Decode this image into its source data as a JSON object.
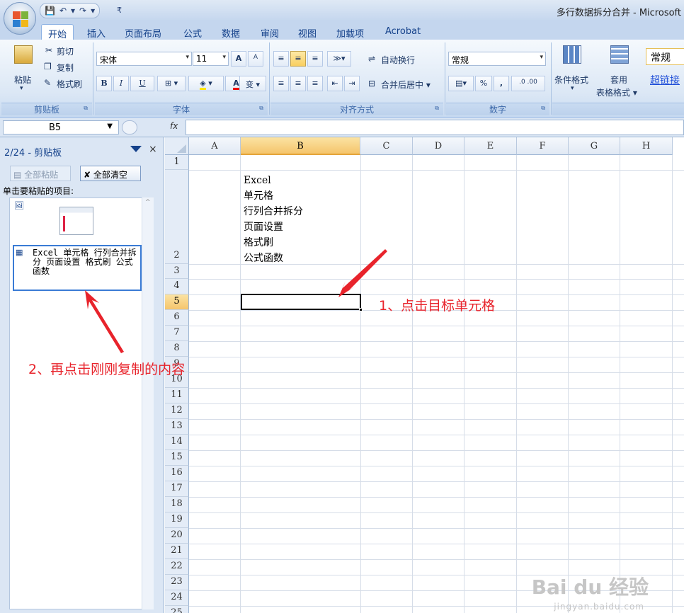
{
  "window": {
    "title": "多行数据拆分合并 - Microsoft"
  },
  "quick_access": {
    "save": "💾",
    "undo": "↶",
    "redo": "↷"
  },
  "tabs": [
    "开始",
    "插入",
    "页面布局",
    "公式",
    "数据",
    "审阅",
    "视图",
    "加载项",
    "Acrobat"
  ],
  "ribbon": {
    "clipboard": {
      "paste": "粘贴",
      "cut": "剪切",
      "copy": "复制",
      "format_painter": "格式刷",
      "label": "剪贴板"
    },
    "font": {
      "name": "宋体",
      "size": "11",
      "grow": "A",
      "shrink": "A",
      "bold": "B",
      "italic": "I",
      "underline": "U",
      "label": "字体",
      "wen": "变"
    },
    "alignment": {
      "wrap": "自动换行",
      "merge": "合并后居中",
      "label": "对齐方式"
    },
    "number": {
      "format": "常规",
      "percent": "%",
      "comma": ",",
      "inc": ".0 .00",
      "label": "数字"
    },
    "styles": {
      "conditional": "条件格式",
      "table_top": "套用",
      "table_bottom": "表格格式",
      "style_normal": "常规",
      "style_hyperlink": "超链接"
    }
  },
  "formula_bar": {
    "name_box": "B5",
    "fx": "fx",
    "content": ""
  },
  "clipboard_pane": {
    "title": "2/24 - 剪贴板",
    "close": "×",
    "paste_all": "全部粘贴",
    "clear_all": "全部清空",
    "hint": "单击要粘贴的项目:",
    "item2_text": "Excel 单元格 行列合并拆分 页面设置 格式刷 公式函数"
  },
  "sheet": {
    "columns": [
      "A",
      "B",
      "C",
      "D",
      "E",
      "F",
      "G",
      "H"
    ],
    "rows": [
      "1",
      "2",
      "3",
      "4",
      "5",
      "6",
      "7",
      "8",
      "9",
      "10",
      "11",
      "12",
      "13",
      "14",
      "15",
      "16",
      "17",
      "18",
      "19",
      "20",
      "21",
      "22",
      "23",
      "24",
      "25"
    ],
    "cell_b2": "Excel\n单元格\n行列合并拆分\n页面设置\n格式刷\n公式函数",
    "selected_column": "B",
    "selected_row": "5"
  },
  "annotations": {
    "step1": "1、点击目标单元格",
    "step2": "2、再点击刚刚复制的内容"
  },
  "watermark": {
    "brand": "Bai du 经验",
    "url": "jingyan.baidu.com"
  },
  "colors": {
    "annotation": "#e8232b",
    "selected_header": "#f5c56c",
    "ribbon_bg": "#dbe7f5"
  }
}
